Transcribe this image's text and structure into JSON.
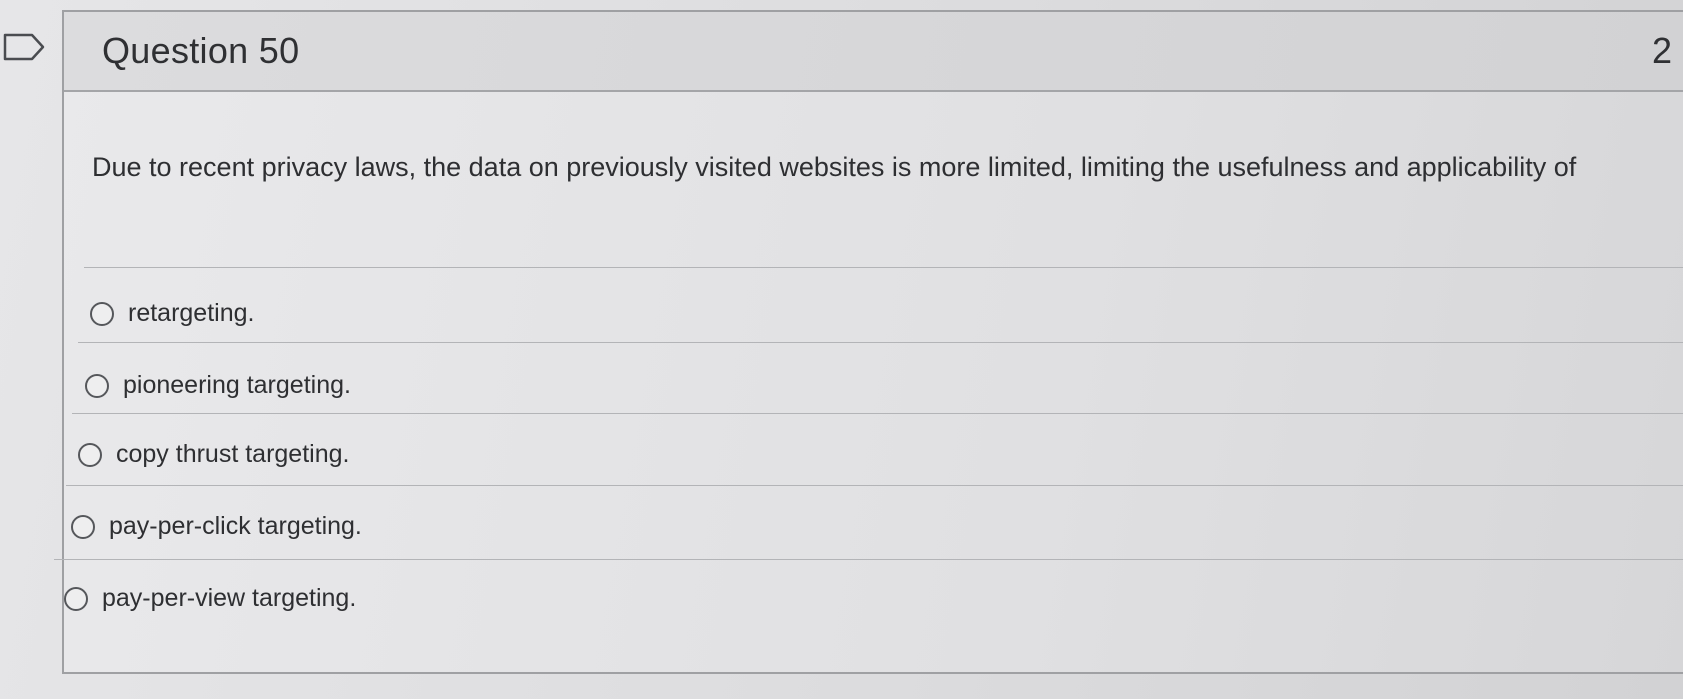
{
  "question": {
    "title": "Question 50",
    "points": "2",
    "text": "Due to recent privacy laws, the data on previously visited websites is more limited, limiting the usefulness and applicability of"
  },
  "answers": [
    {
      "label": "retargeting.",
      "selected": false
    },
    {
      "label": "pioneering targeting.",
      "selected": false
    },
    {
      "label": "copy thrust targeting.",
      "selected": false
    },
    {
      "label": "pay-per-click targeting.",
      "selected": false
    },
    {
      "label": "pay-per-view targeting.",
      "selected": false
    }
  ],
  "icons": {
    "flag": "flag-icon"
  }
}
